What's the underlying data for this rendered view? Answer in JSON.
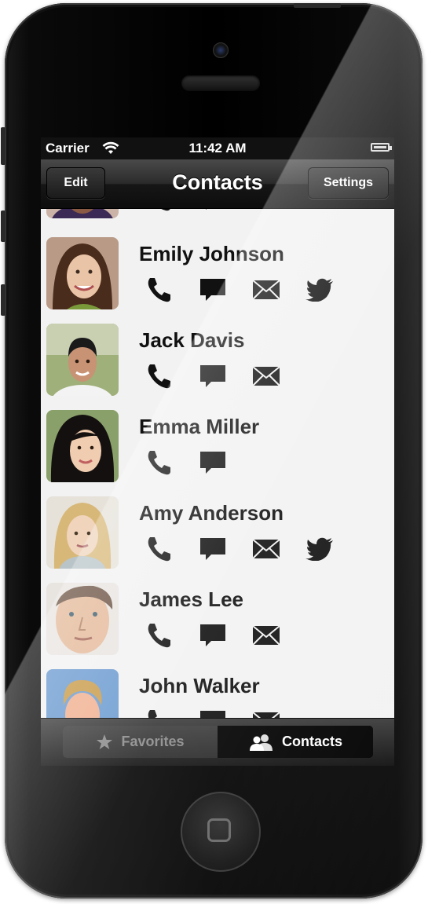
{
  "status_bar": {
    "carrier": "Carrier",
    "time": "11:42 AM"
  },
  "nav": {
    "title": "Contacts",
    "left_button": "Edit",
    "right_button": "Settings"
  },
  "contacts": [
    {
      "name": "Emily Johnson",
      "actions": [
        "phone-icon",
        "message-icon",
        "mail-icon",
        "twitter-icon"
      ]
    },
    {
      "name": "Jack Davis",
      "actions": [
        "phone-icon",
        "message-icon",
        "mail-icon"
      ]
    },
    {
      "name": "Emma Miller",
      "actions": [
        "phone-icon",
        "message-icon"
      ]
    },
    {
      "name": "Amy Anderson",
      "actions": [
        "phone-icon",
        "message-icon",
        "mail-icon",
        "twitter-icon"
      ]
    },
    {
      "name": "James Lee",
      "actions": [
        "phone-icon",
        "message-icon",
        "mail-icon"
      ]
    },
    {
      "name": "John Walker",
      "actions": [
        "phone-icon",
        "message-icon",
        "mail-icon"
      ]
    }
  ],
  "tabs": {
    "favorites": "Favorites",
    "contacts": "Contacts",
    "selected": "contacts"
  },
  "colors": {
    "list_background": "#f2f2f2",
    "nav_bar": "#1a1a1a",
    "tab_selected": "#000000"
  }
}
